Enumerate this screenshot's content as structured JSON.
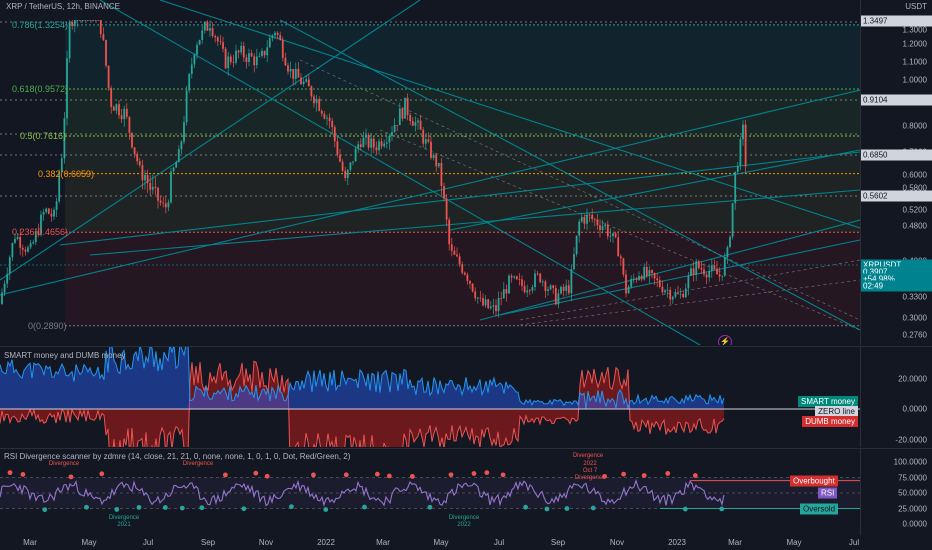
{
  "header": {
    "symbol": "XRP / TetherUS, 12h, BINANCE",
    "currency": "USDT"
  },
  "colors": {
    "background": "#131722",
    "up": "#26a69a",
    "down": "#ef5350",
    "smart": "#2962ff",
    "dumb": "#b71c1c",
    "rsi": "#9575cd",
    "trendline": "#00838f"
  },
  "fib_levels": [
    {
      "label": "0.786(1.3254)",
      "price": 1.3254
    },
    {
      "label": "0.618(0.9572)",
      "price": 0.9572
    },
    {
      "label": "0.5(0.7616)",
      "price": 0.7616
    },
    {
      "label": "0.382(0.6059)",
      "price": 0.6059
    },
    {
      "label": "0.236(0.4656)",
      "price": 0.4656
    },
    {
      "label": "0(0.2890)",
      "price": 0.289
    }
  ],
  "price_axis": {
    "ticks": [
      "1.3000",
      "1.2000",
      "1.1000",
      "1.0000",
      "0.9000",
      "0.8000",
      "0.7000",
      "0.6000",
      "0.5800",
      "0.5200",
      "0.4800",
      "0.4000",
      "0.3700",
      "0.3300",
      "0.3000",
      "0.2760"
    ],
    "tags": [
      {
        "text": "1.3497",
        "style": "white"
      },
      {
        "text": "0.9104",
        "style": "white"
      },
      {
        "text": "0.6850",
        "style": "white"
      },
      {
        "text": "0.5602",
        "style": "white"
      },
      {
        "text": "XRPUSDT",
        "style": "teal"
      },
      {
        "text": "0.3907",
        "style": "teal"
      },
      {
        "text": "+54.98%",
        "style": "teal"
      },
      {
        "text": "02:49",
        "style": "teal"
      }
    ]
  },
  "smart_dumb": {
    "title": "SMART money and DUMB money",
    "ticks": [
      "20.0000",
      "0.0000",
      "-20.0000"
    ],
    "tags": [
      {
        "text": "SMART money",
        "style": "teal"
      },
      {
        "text": "ZERO line",
        "style": "gray"
      },
      {
        "text": "DUMB money",
        "style": "red"
      }
    ]
  },
  "rsi_panel": {
    "title": "RSI Divergence scanner by zdmre (14, close, 21, 21, 0, none, none, 1, 0, 1, 0, Dot, Red/Green, 2)",
    "ticks": [
      "100.0000",
      "75.0000",
      "50.0000",
      "25.0000",
      "0.0000"
    ],
    "overbought_label": "Overbought",
    "rsi_label": "RSI",
    "oversold_label": "Oversold",
    "annotations": [
      {
        "text": "Divergence",
        "color": "red"
      },
      {
        "text": "Divergence",
        "color": "red"
      },
      {
        "text": "Divergence",
        "color": "red"
      },
      {
        "text": "2022\nOct 7\nDivergence",
        "color": "red"
      },
      {
        "text": "Divergence\n2021",
        "color": "green"
      },
      {
        "text": "Divergence\n2022",
        "color": "green"
      }
    ]
  },
  "time_axis": [
    "Mar",
    "May",
    "Jul",
    "Sep",
    "Nov",
    "2022",
    "Mar",
    "May",
    "Jul",
    "Sep",
    "Nov",
    "2023",
    "Mar",
    "May",
    "Jul"
  ]
}
